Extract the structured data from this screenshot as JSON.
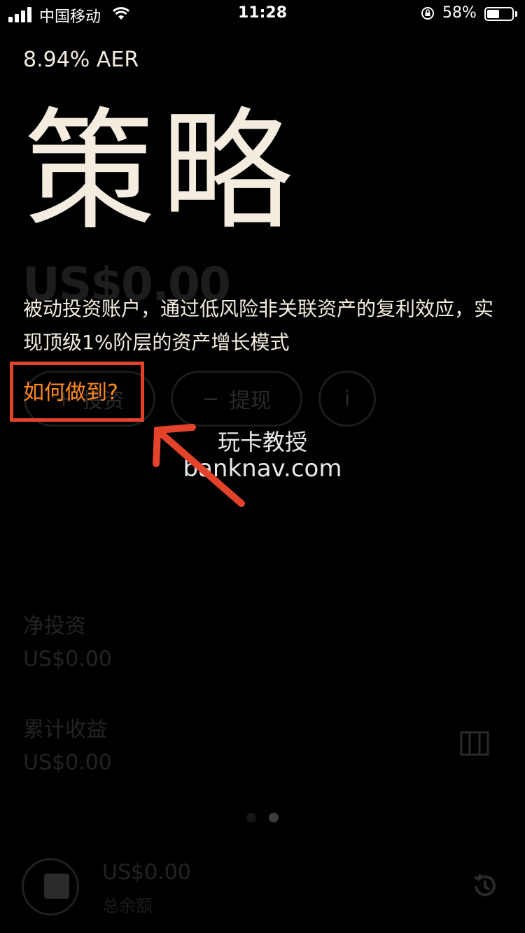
{
  "status_bar": {
    "carrier": "中国移动",
    "time": "11:28",
    "battery": "58%"
  },
  "header": {
    "rate": "8.94% AER",
    "title": "策略"
  },
  "balance_ghost": "US$0.00",
  "description": "被动投资账户，通过低风险非关联资产的复利效应，实现顶级1%阶层的资产增长模式",
  "how_link": "如何做到?",
  "buttons": {
    "invest": "投资",
    "withdraw": "提现",
    "info": "i"
  },
  "watermark": {
    "line1": "玩卡教授",
    "line2": "banknav.com"
  },
  "stats": {
    "net_investment_label": "净投资",
    "net_investment_value": "US$0.00",
    "cumulative_gain_label": "累计收益",
    "cumulative_gain_value": "US$0.00"
  },
  "bottom": {
    "total_value": "US$0.00",
    "total_label": "总余额"
  },
  "colors": {
    "accent": "#ff8a1e",
    "highlight_box": "#e2432a",
    "text": "#f3ecdf"
  }
}
